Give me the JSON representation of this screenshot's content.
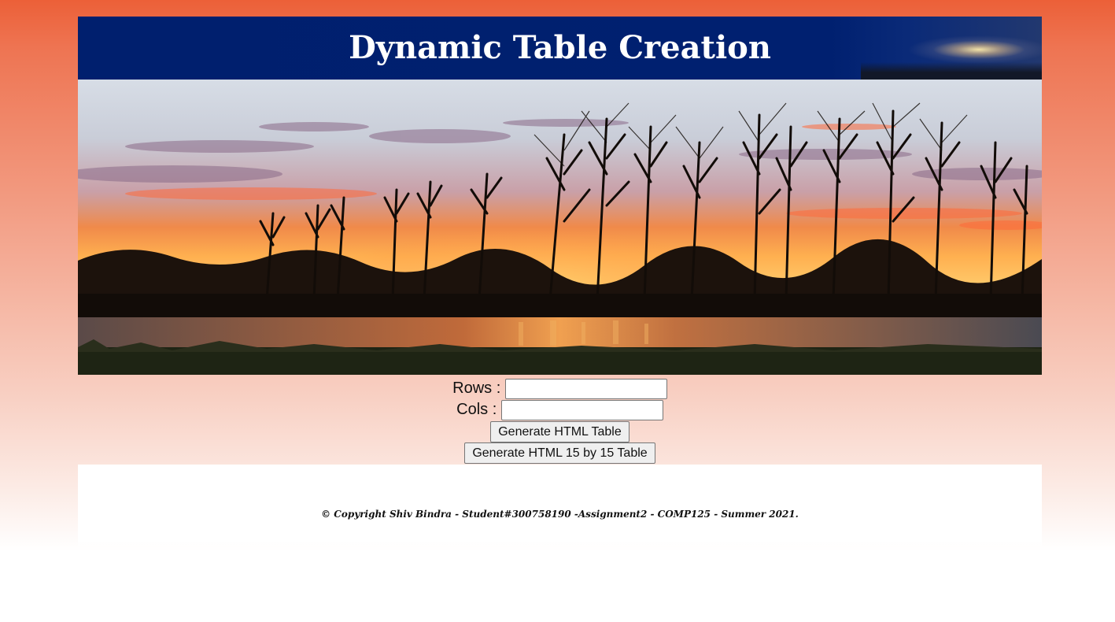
{
  "header": {
    "title": "Dynamic Table Creation"
  },
  "hero": {
    "image": "sunset-over-lake-with-bare-trees"
  },
  "form": {
    "rows_label": "Rows :",
    "rows_value": "",
    "cols_label": "Cols :",
    "cols_value": "",
    "generate_button": "Generate HTML Table",
    "generate_15_button": "Generate HTML 15 by 15 Table"
  },
  "footer": {
    "copyright": "© Copyright Shiv Bindra - Student#300758190 -Assignment2 - COMP125 - Summer 2021."
  },
  "colors": {
    "header_bg": "#002070",
    "page_gradient_top": "#ec6038",
    "page_gradient_bottom": "#ffffff"
  }
}
